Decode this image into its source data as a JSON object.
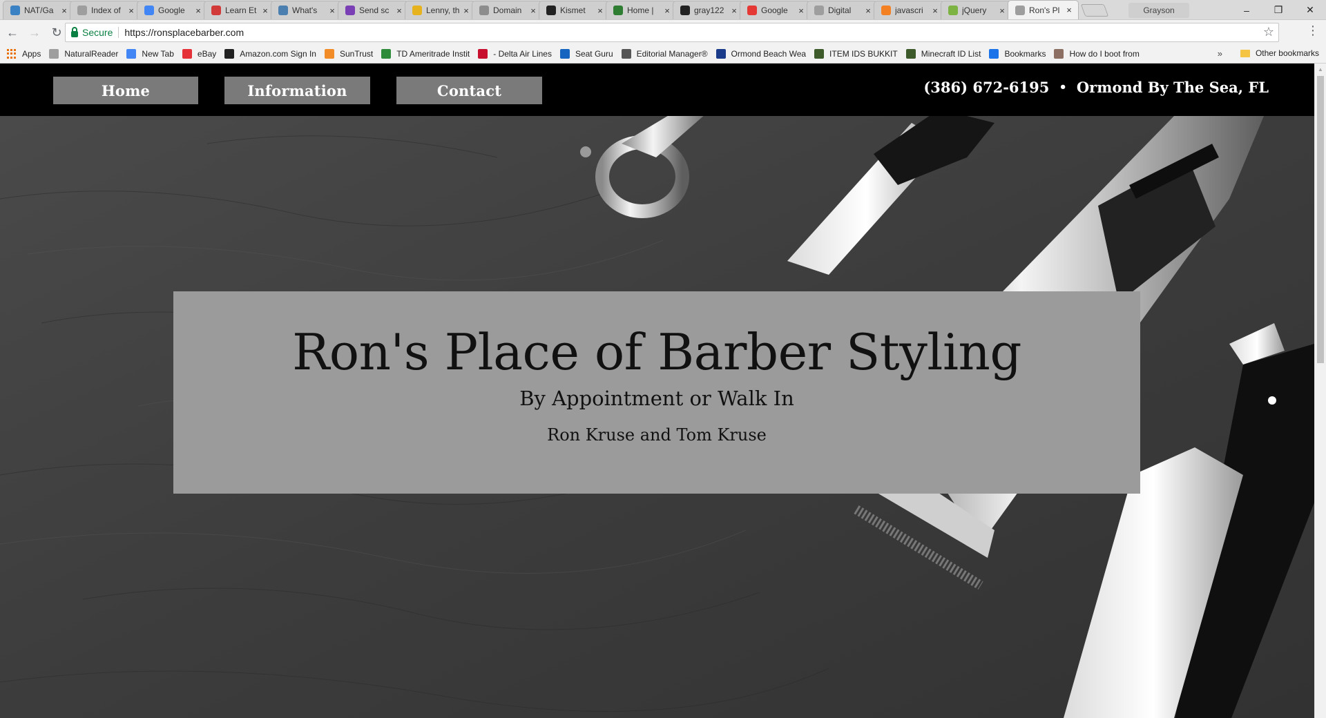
{
  "browser": {
    "tabs": [
      {
        "label": "NAT/Ga",
        "icon": "globe-icon",
        "color": "#3b82c4"
      },
      {
        "label": "Index of",
        "icon": "document-icon",
        "color": "#9e9e9e"
      },
      {
        "label": "Google",
        "icon": "google-icon",
        "color": "#4285f4"
      },
      {
        "label": "Learn Et",
        "icon": "learn-icon",
        "color": "#d23a3a"
      },
      {
        "label": "What's",
        "icon": "eye-icon",
        "color": "#4a7fb0"
      },
      {
        "label": "Send sc",
        "icon": "send-icon",
        "color": "#7b3fb5"
      },
      {
        "label": "Lenny, th",
        "icon": "smiley-icon",
        "color": "#e6b31e"
      },
      {
        "label": "Domain",
        "icon": "domain-icon",
        "color": "#8d8d8d"
      },
      {
        "label": "Kismet",
        "icon": "hourglass-icon",
        "color": "#222222"
      },
      {
        "label": "Home |",
        "icon": "home-icon",
        "color": "#2e7d32"
      },
      {
        "label": "gray122",
        "icon": "github-icon",
        "color": "#222222"
      },
      {
        "label": "Google",
        "icon": "google-forms-icon",
        "color": "#e53935"
      },
      {
        "label": "Digital",
        "icon": "document-icon",
        "color": "#9e9e9e"
      },
      {
        "label": "javascri",
        "icon": "stack-icon",
        "color": "#f48024"
      },
      {
        "label": "jQuery",
        "icon": "jquery-icon",
        "color": "#7cb342"
      },
      {
        "label": "Ron's Pl",
        "icon": "document-icon",
        "color": "#9e9e9e",
        "active": true
      }
    ],
    "profile_name": "Grayson",
    "address": {
      "secure_label": "Secure",
      "url": "https://ronsplacebarber.com"
    },
    "bookmarks": [
      {
        "label": "Apps",
        "icon": "apps-icon"
      },
      {
        "label": "NaturalReader",
        "icon": "document-icon"
      },
      {
        "label": "New Tab",
        "icon": "google-icon"
      },
      {
        "label": "eBay",
        "icon": "ebay-icon"
      },
      {
        "label": "Amazon.com Sign In",
        "icon": "amazon-icon"
      },
      {
        "label": "SunTrust",
        "icon": "suntrust-icon"
      },
      {
        "label": "TD Ameritrade Instit",
        "icon": "td-icon"
      },
      {
        "label": "- Delta Air Lines",
        "icon": "delta-icon"
      },
      {
        "label": "Seat Guru",
        "icon": "seat-icon"
      },
      {
        "label": "Editorial Manager®",
        "icon": "editorial-icon"
      },
      {
        "label": "Ormond Beach Wea",
        "icon": "weather-icon"
      },
      {
        "label": "ITEM IDS BUKKIT",
        "icon": "cube-icon"
      },
      {
        "label": "Minecraft ID List",
        "icon": "cube-icon"
      },
      {
        "label": "Bookmarks",
        "icon": "star-icon"
      },
      {
        "label": "How do I boot from",
        "icon": "avatar-icon"
      }
    ],
    "bookmarks_overflow": "»",
    "other_bookmarks": "Other bookmarks"
  },
  "site": {
    "nav": {
      "home": "Home",
      "information": "Information",
      "contact": "Contact"
    },
    "phone": "(386) 672-6195",
    "bullet": "•",
    "location": "Ormond By The Sea, FL",
    "banner": {
      "title": "Ron's Place of Barber Styling",
      "subtitle": "By Appointment or Walk In",
      "names": "Ron Kruse and Tom Kruse"
    }
  }
}
